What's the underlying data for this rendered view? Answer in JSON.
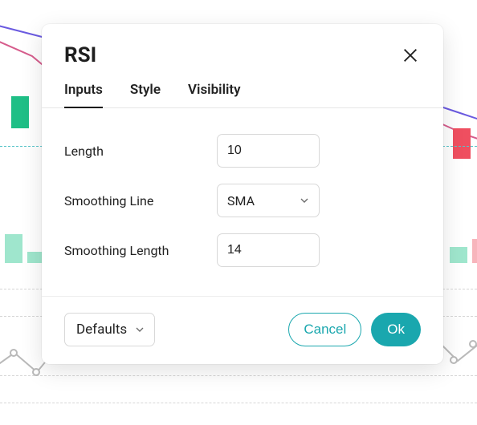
{
  "colors": {
    "accent": "#1aa7ae",
    "green": "#1fbf86",
    "lightgreen": "#9fe6cd",
    "red": "#ef4f60",
    "lightred": "#f7b5bc",
    "purple": "#6a5ae0",
    "pink": "#d65c8c"
  },
  "modal": {
    "title": "RSI",
    "tabs": [
      {
        "id": "inputs",
        "label": "Inputs",
        "active": true
      },
      {
        "id": "style",
        "label": "Style",
        "active": false
      },
      {
        "id": "visibility",
        "label": "Visibility",
        "active": false
      }
    ],
    "inputs": {
      "length": {
        "label": "Length",
        "value": "10"
      },
      "smoothing_line": {
        "label": "Smoothing Line",
        "value": "SMA"
      },
      "smoothing_length": {
        "label": "Smoothing Length",
        "value": "14"
      }
    },
    "footer": {
      "defaults_label": "Defaults",
      "cancel_label": "Cancel",
      "ok_label": "Ok"
    }
  }
}
